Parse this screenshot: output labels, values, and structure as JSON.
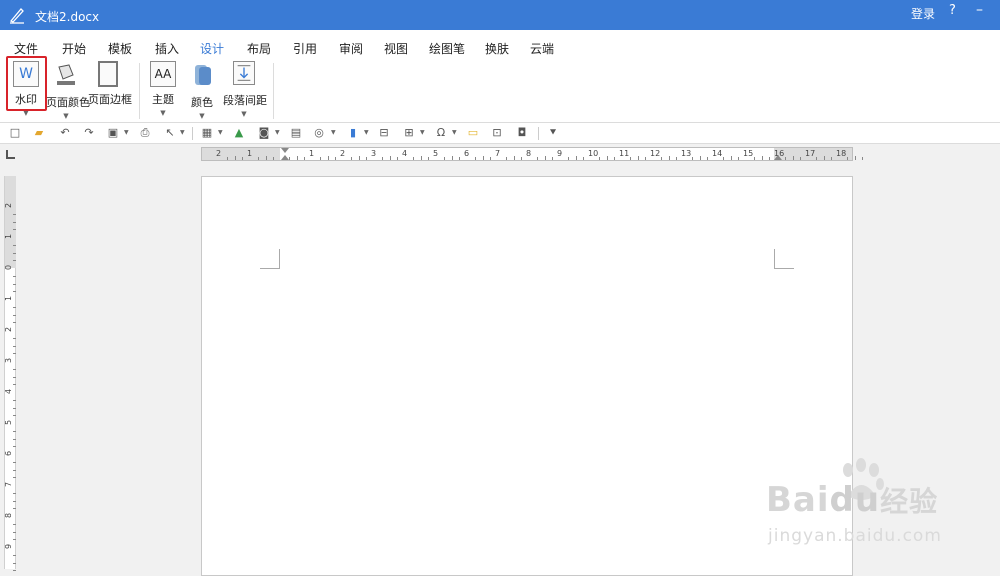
{
  "titlebar": {
    "doc_title": "文档2.docx",
    "login": "登录",
    "help": "?",
    "minimize": "–"
  },
  "menu": [
    "文件",
    "开始",
    "模板",
    "插入",
    "设计",
    "布局",
    "引用",
    "审阅",
    "视图",
    "绘图笔",
    "换肤",
    "云端"
  ],
  "active_tab": "设计",
  "ribbon": {
    "watermark": "水印",
    "page_color": "页面颜色",
    "page_border": "页面边框",
    "theme": "主题",
    "colors": "颜色",
    "paragraph_spacing": "段落间距",
    "theme_icon_text": "AA",
    "watermark_icon_text": "W"
  },
  "ruler": {
    "h_numbers": [
      "2",
      "1",
      "",
      "1",
      "2",
      "3",
      "4",
      "5",
      "6",
      "7",
      "8",
      "9",
      "10",
      "11",
      "12",
      "13",
      "14",
      "15",
      "16",
      "17",
      "18"
    ],
    "v_numbers": [
      "2",
      "1",
      "0",
      "1",
      "2",
      "3",
      "4",
      "5",
      "6",
      "7",
      "8",
      "9"
    ]
  },
  "watermark_logo": {
    "brand": "Bai",
    "brand2": "du",
    "cn": "经验",
    "url": "jingyan.baidu.com"
  },
  "colors": {
    "accent": "#3a7bd5",
    "highlight": "#d8232a"
  }
}
